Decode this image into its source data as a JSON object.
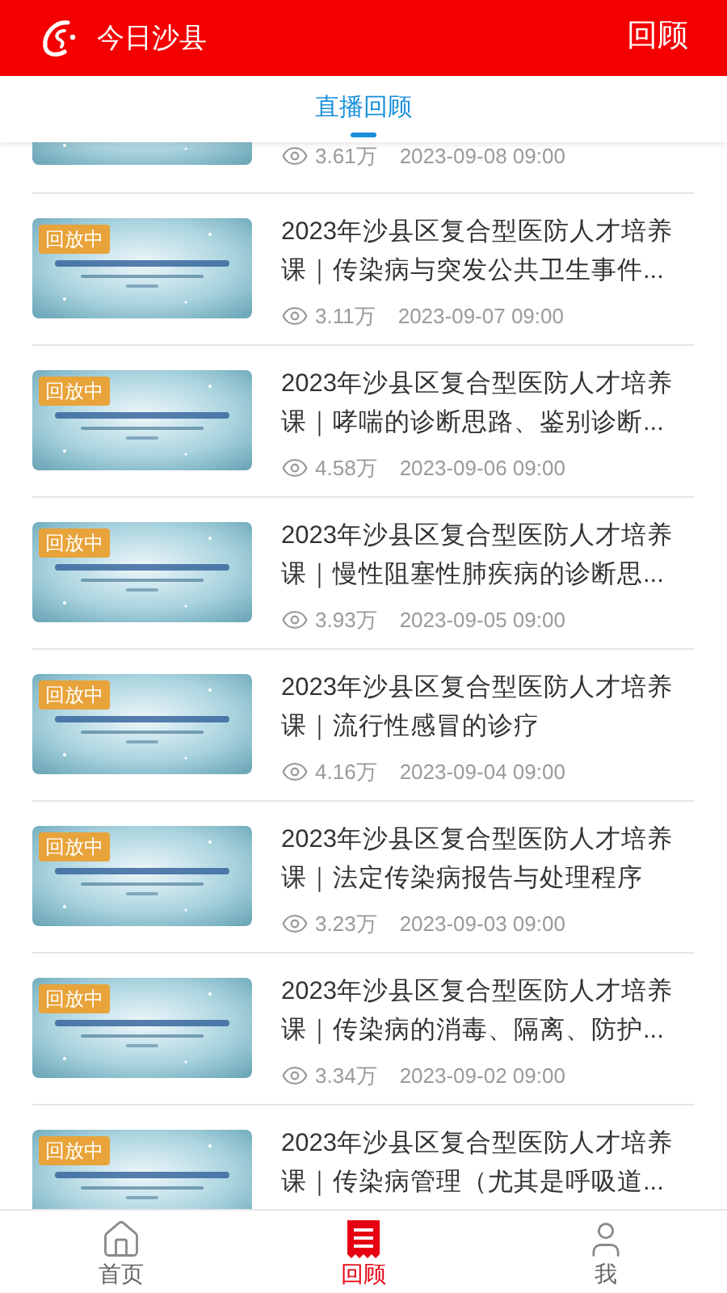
{
  "header": {
    "app_name": "今日沙县",
    "page_title": "回顾"
  },
  "tabs": [
    {
      "label": "直播回顾",
      "selected": true
    }
  ],
  "videos": [
    {
      "kind": "partial",
      "views": "3.61万",
      "date": "2023-09-08 09:00"
    },
    {
      "kind": "full",
      "badge": "回放中",
      "title": "2023年沙县区复合型医防人才培养课｜传染病与突发公共卫生事件...",
      "views": "3.11万",
      "date": "2023-09-07 09:00"
    },
    {
      "kind": "full",
      "badge": "回放中",
      "title": "2023年沙县区复合型医防人才培养课｜哮喘的诊断思路、鉴别诊断...",
      "views": "4.58万",
      "date": "2023-09-06 09:00"
    },
    {
      "kind": "full",
      "badge": "回放中",
      "title": "2023年沙县区复合型医防人才培养课｜慢性阻塞性肺疾病的诊断思...",
      "views": "3.93万",
      "date": "2023-09-05 09:00"
    },
    {
      "kind": "full",
      "badge": "回放中",
      "title": "2023年沙县区复合型医防人才培养课｜流行性感冒的诊疗",
      "views": "4.16万",
      "date": "2023-09-04 09:00"
    },
    {
      "kind": "full",
      "badge": "回放中",
      "title": "2023年沙县区复合型医防人才培养课｜法定传染病报告与处理程序",
      "views": "3.23万",
      "date": "2023-09-03 09:00"
    },
    {
      "kind": "full",
      "badge": "回放中",
      "title": "2023年沙县区复合型医防人才培养课｜传染病的消毒、隔离、防护...",
      "views": "3.34万",
      "date": "2023-09-02 09:00"
    },
    {
      "kind": "cut",
      "badge": "回放中",
      "title": "2023年沙县区复合型医防人才培养课｜传染病管理（尤其是呼吸道..."
    }
  ],
  "bottom_nav": [
    {
      "kind": "home",
      "label": "首页",
      "selected": false
    },
    {
      "kind": "review",
      "label": "回顾",
      "selected": true
    },
    {
      "kind": "me",
      "label": "我",
      "selected": false
    }
  ]
}
